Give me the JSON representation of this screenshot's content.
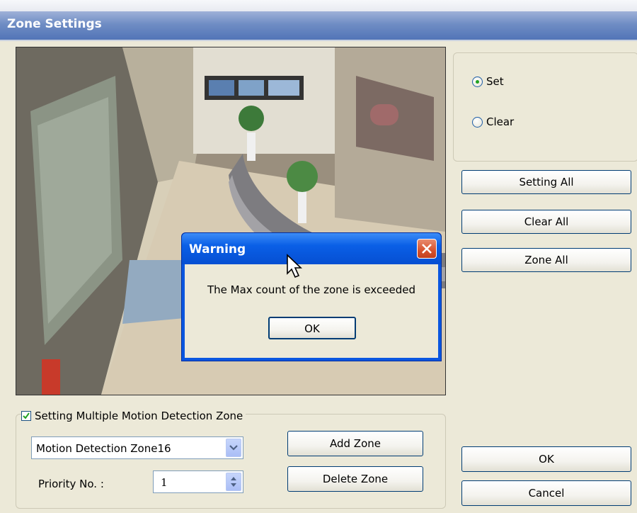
{
  "window": {
    "title": "Zone Settings"
  },
  "mode": {
    "options": [
      {
        "label": "Set",
        "selected": true
      },
      {
        "label": "Clear",
        "selected": false
      }
    ]
  },
  "right_buttons": {
    "setting_all": "Setting All",
    "clear_all": "Clear All",
    "zone_all": "Zone All"
  },
  "zones": {
    "multi_zone_label": "Setting Multiple Motion Detection Zone",
    "multi_zone_checked": true,
    "selected_zone": "Motion Detection Zone16",
    "priority_label": "Priority No. :",
    "priority_value": "1",
    "add_zone": "Add Zone",
    "delete_zone": "Delete Zone"
  },
  "footer": {
    "ok": "OK",
    "cancel": "Cancel"
  },
  "warning": {
    "title": "Warning",
    "message": "The Max count of the zone is exceeded",
    "ok": "OK"
  },
  "colors": {
    "title_blue": "#5274b7",
    "dialog_blue": "#0a56e0",
    "window_bg": "#ece9d8",
    "close_red": "#d7522e",
    "button_border": "#003c74"
  }
}
